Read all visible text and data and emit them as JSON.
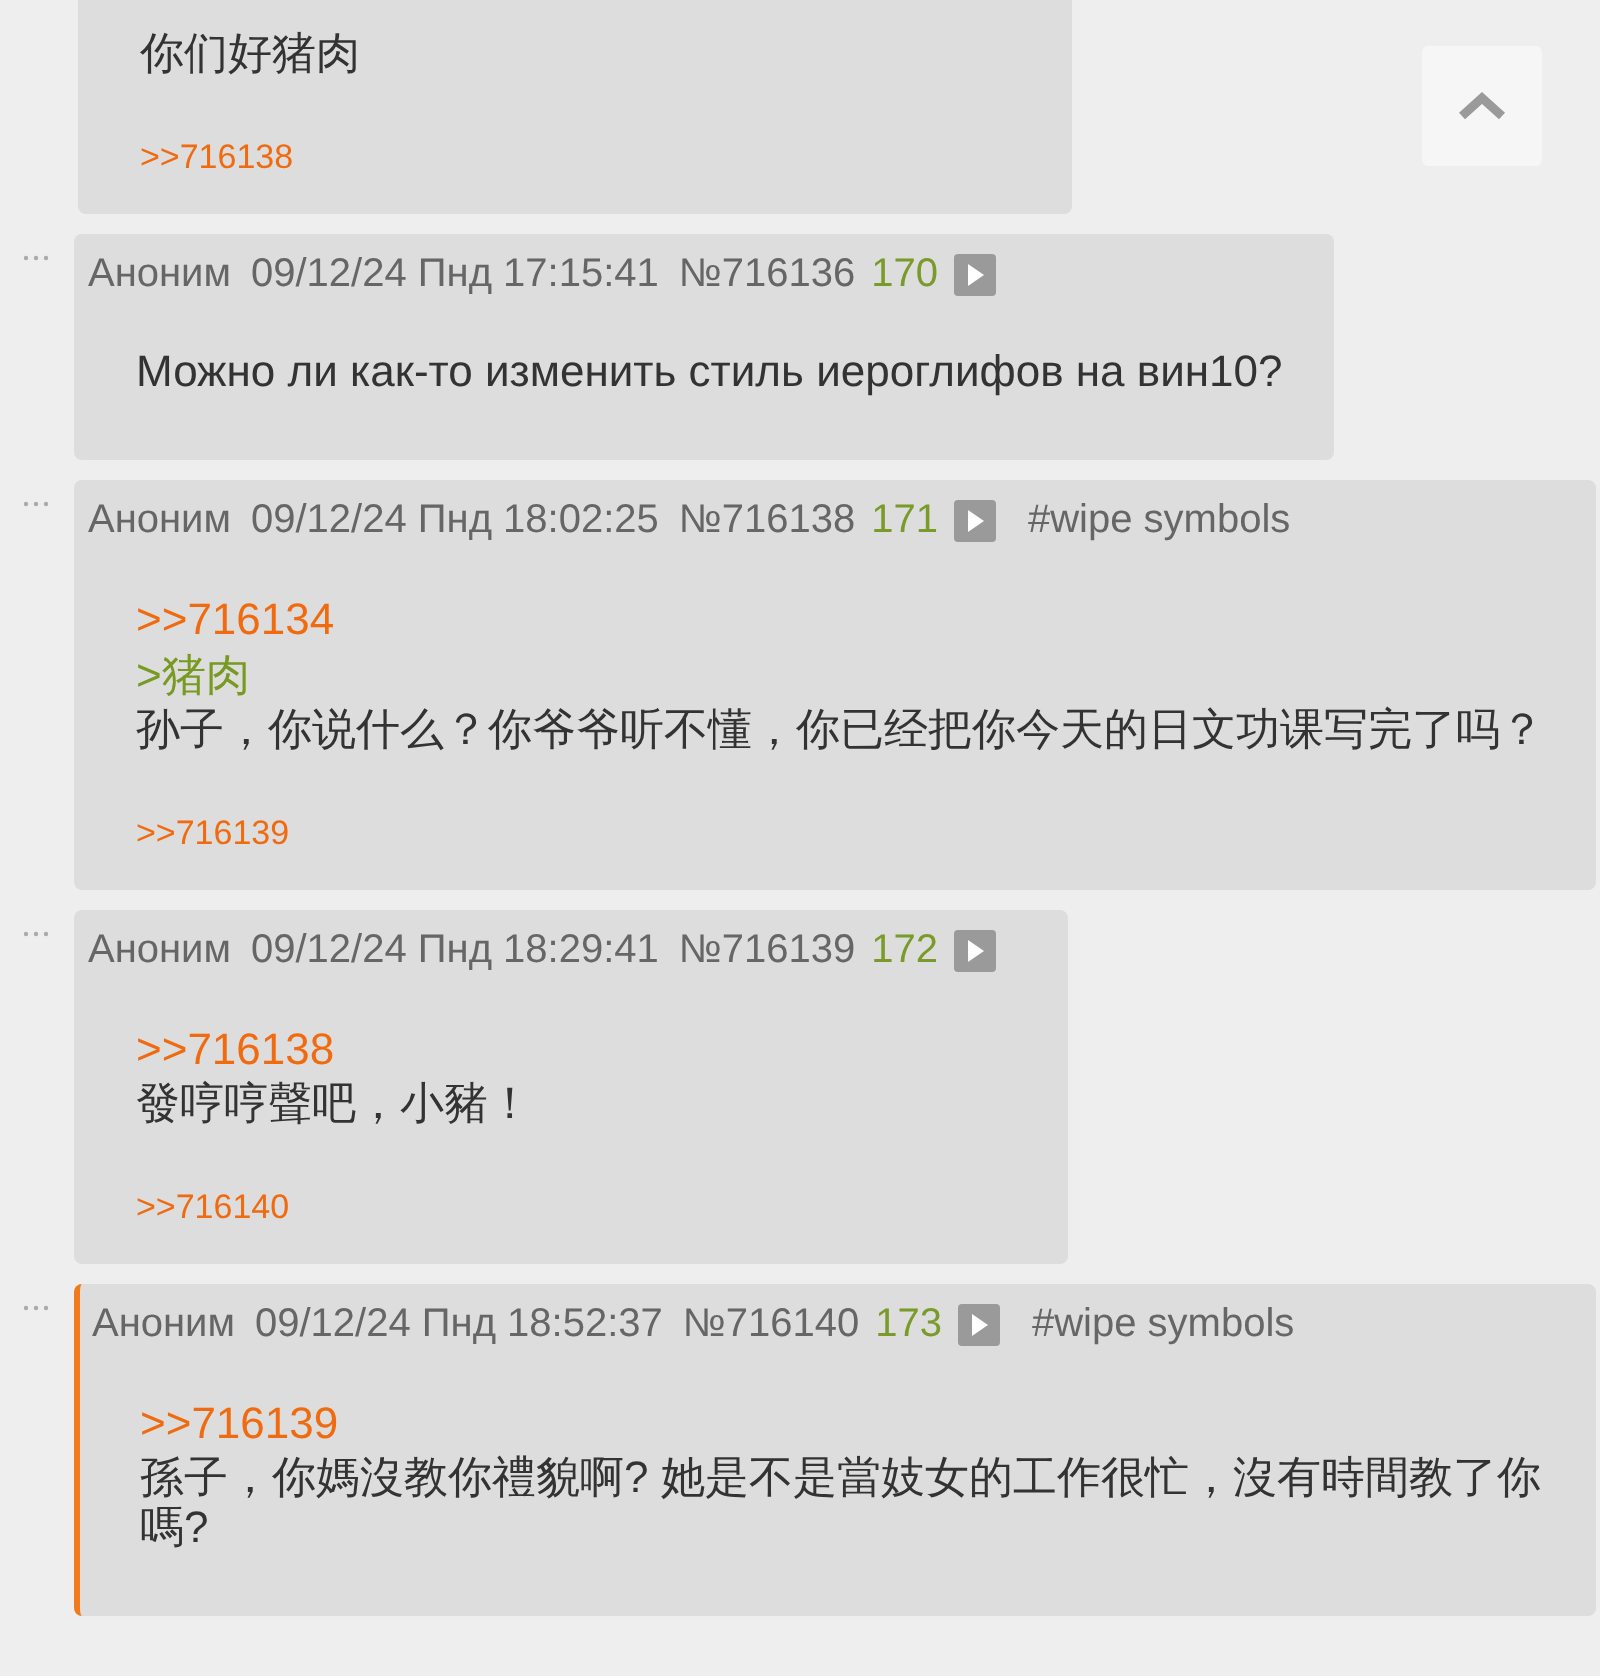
{
  "posts": [
    {
      "highlighted": false,
      "body": [
        {
          "kind": "text",
          "text": "你们好猪肉"
        }
      ],
      "replies": [
        ">>716138"
      ]
    },
    {
      "highlighted": false,
      "header": {
        "name": "Аноним",
        "date": "09/12/24 Пнд 17:15:41",
        "number": "№716136",
        "count": "170"
      },
      "body": [
        {
          "kind": "text",
          "text": "Можно ли как-то изменить стиль иероглифов на вин10?"
        }
      ]
    },
    {
      "highlighted": false,
      "header": {
        "name": "Аноним",
        "date": "09/12/24 Пнд 18:02:25",
        "number": "№716138",
        "count": "171",
        "tag": "#wipe symbols"
      },
      "body": [
        {
          "kind": "reply",
          "text": ">>716134"
        },
        {
          "kind": "quote",
          "text": ">猪肉"
        },
        {
          "kind": "text",
          "text": "孙子，你说什么？你爷爷听不懂，你已经把你今天的日文功课写完了吗？"
        }
      ],
      "replies": [
        ">>716139"
      ]
    },
    {
      "highlighted": false,
      "header": {
        "name": "Аноним",
        "date": "09/12/24 Пнд 18:29:41",
        "number": "№716139",
        "count": "172"
      },
      "body": [
        {
          "kind": "reply",
          "text": ">>716138"
        },
        {
          "kind": "text",
          "text": "發哼哼聲吧，小豬！"
        }
      ],
      "replies": [
        ">>716140"
      ]
    },
    {
      "highlighted": true,
      "header": {
        "name": "Аноним",
        "date": "09/12/24 Пнд 18:52:37",
        "number": "№716140",
        "count": "173",
        "tag": "#wipe symbols"
      },
      "body": [
        {
          "kind": "reply",
          "text": ">>716139"
        },
        {
          "kind": "text",
          "text": "孫子，你媽沒教你禮貌啊? 她是不是當妓女的工作很忙，沒有時間教了你嗎?"
        }
      ]
    }
  ]
}
